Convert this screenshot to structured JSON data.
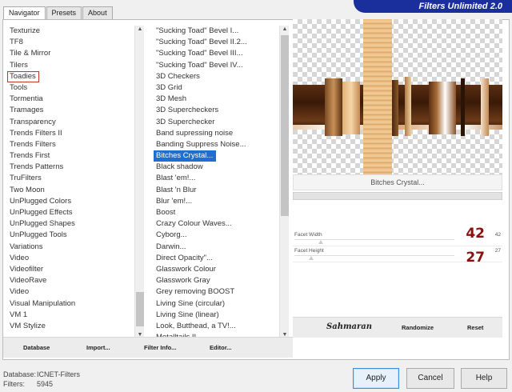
{
  "tabs": [
    {
      "label": "Navigator",
      "active": true
    },
    {
      "label": "Presets",
      "active": false
    },
    {
      "label": "About",
      "active": false
    }
  ],
  "banner": {
    "title": "Filters Unlimited 2.0"
  },
  "navigator": {
    "items": [
      "Texturize",
      "TF8",
      "Tile & Mirror",
      "Tilers",
      "Toadies",
      "Tools",
      "Tormentia",
      "Tramages",
      "Transparency",
      "Trends Filters II",
      "Trends Filters",
      "Trends First",
      "Trends Patterns",
      "TruFilters",
      "Two Moon",
      "UnPlugged Colors",
      "UnPlugged Effects",
      "UnPlugged Shapes",
      "UnPlugged Tools",
      "Variations",
      "Video",
      "Videofilter",
      "VideoRave",
      "Video",
      "Visual Manipulation",
      "VM 1",
      "VM Stylize"
    ],
    "boxed_item": "Toadies"
  },
  "filters": {
    "items": [
      "\"Sucking Toad\"  Bevel I...",
      "\"Sucking Toad\"  Bevel II.2...",
      "\"Sucking Toad\"  Bevel III...",
      "\"Sucking Toad\"  Bevel IV...",
      "3D Checkers",
      "3D Grid",
      "3D Mesh",
      "3D Supercheckers",
      "3D Superchecker",
      "Band supressing noise",
      "Banding Suppress Noise...",
      "Bitches Crystal...",
      "Black shadow",
      "Blast 'em!...",
      "Blast 'n Blur",
      "Blur 'em!...",
      "Boost",
      "Crazy Colour Waves...",
      "Cyborg...",
      "Darwin...",
      "Direct Opacity\"...",
      "Glasswork Colour",
      "Glasswork Gray",
      "Grey removing BOOST",
      "Living Sine (circular)",
      "Living Sine (linear)",
      "Look, Butthead, a TV!...",
      "Metalltails II"
    ],
    "selected_item": "Bitches Crystal..."
  },
  "left_buttons": {
    "database": "Database",
    "import": "Import...",
    "filter_info": "Filter Info...",
    "editor": "Editor..."
  },
  "filter_title": "Bitches Crystal...",
  "params": [
    {
      "label": "Facet Width",
      "value": "42",
      "small": "42",
      "level": 0.165
    },
    {
      "label": "Facet Height",
      "value": "27",
      "small": "27",
      "level": 0.106
    }
  ],
  "right_buttons": {
    "logo": "Sahmaran",
    "randomize": "Randomize",
    "reset": "Reset"
  },
  "footer": {
    "database_label": "Database:",
    "database_value": "ICNET-Filters",
    "filters_label": "Filters:",
    "filters_value": "5945"
  },
  "actions": {
    "apply": "Apply",
    "cancel": "Cancel",
    "help": "Help"
  },
  "colors": {
    "accent": "#1a2f9c",
    "selection": "#1f6fd1",
    "value_text": "#8b1111",
    "highlight_box": "#c0392b"
  }
}
